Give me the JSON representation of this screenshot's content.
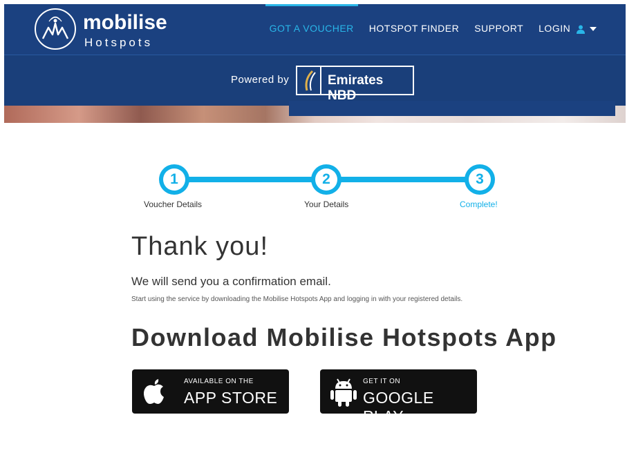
{
  "brand": {
    "name": "mobilise",
    "sub": "Hotspots",
    "primary_color": "#1b4180",
    "accent_color": "#12b0e8"
  },
  "nav": {
    "items": [
      {
        "label": "GOT A VOUCHER",
        "active": true
      },
      {
        "label": "HOTSPOT FINDER",
        "active": false
      },
      {
        "label": "SUPPORT",
        "active": false
      },
      {
        "label": "LOGIN",
        "active": false
      }
    ],
    "login_icons": [
      "user-icon",
      "caret-down-icon"
    ]
  },
  "sponsor": {
    "label": "Powered by",
    "name": "Emirates NBD"
  },
  "steps": [
    {
      "number": "1",
      "label": "Voucher Details",
      "current": false
    },
    {
      "number": "2",
      "label": "Your Details",
      "current": false
    },
    {
      "number": "3",
      "label": "Complete!",
      "current": true
    }
  ],
  "confirmation": {
    "title": "Thank you!",
    "message": "We will send you a confirmation email.",
    "detail": "Start using the service by downloading the Mobilise Hotspots App and logging in with your registered details."
  },
  "download": {
    "title": "Download Mobilise Hotspots App",
    "app_store": {
      "small": "AVAILABLE ON THE",
      "big": "APP STORE",
      "icon": "apple-icon"
    },
    "google_play": {
      "small": "GET IT ON",
      "big": "GOOGLE PLAY",
      "icon": "android-icon"
    }
  }
}
